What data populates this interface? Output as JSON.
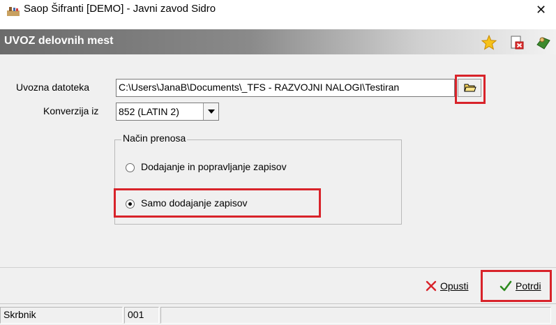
{
  "window": {
    "title": "Saop Šifranti [DEMO] - Javni zavod Sidro",
    "close_glyph": "✕"
  },
  "header": {
    "title": "UVOZ delovnih mest",
    "icons": [
      "star-icon",
      "delete-document-icon",
      "exit-icon"
    ]
  },
  "form": {
    "file_label": "Uvozna datoteka",
    "file_value": "C:\\Users\\JanaB\\Documents\\_TFS - RAZVOJNI NALOGI\\Testiran",
    "conversion_label": "Konverzija iz",
    "conversion_value": "852 (LATIN 2)",
    "transfer_group_label": "Način prenosa",
    "options": [
      {
        "label": "Dodajanje in popravljanje zapisov",
        "selected": false
      },
      {
        "label": "Samo dodajanje zapisov",
        "selected": true
      }
    ]
  },
  "footer": {
    "cancel_label": "Opusti",
    "confirm_label": "Potrdi"
  },
  "status": {
    "user": "Skrbnik",
    "code": "001"
  },
  "colors": {
    "highlight": "#d8232a",
    "cancel_x": "#d8232a",
    "confirm_check": "#2c8a1e"
  }
}
